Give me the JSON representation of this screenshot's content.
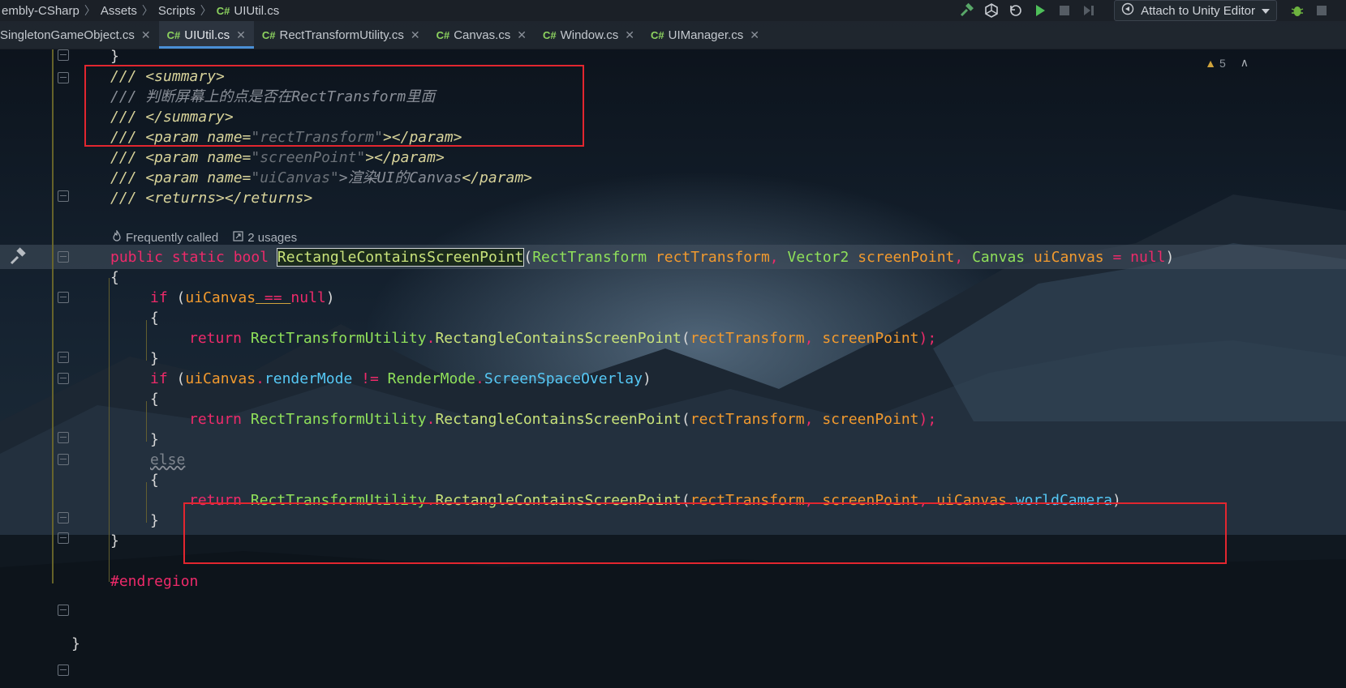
{
  "breadcrumb": {
    "items": [
      "embly-CSharp",
      "Assets",
      "Scripts",
      "UIUtil.cs"
    ],
    "file_glyph": "C#"
  },
  "toolbar": {
    "attach_label": "Attach to Unity Editor"
  },
  "tabs": [
    {
      "label": "SingletonGameObject.cs",
      "active": false
    },
    {
      "label": "UIUtil.cs",
      "active": true
    },
    {
      "label": "RectTransformUtility.cs",
      "active": false
    },
    {
      "label": "Canvas.cs",
      "active": false
    },
    {
      "label": "Window.cs",
      "active": false
    },
    {
      "label": "UIManager.cs",
      "active": false
    }
  ],
  "inspection": {
    "warnings": "5"
  },
  "code_hint": {
    "frequently_called": "Frequently called",
    "usages": "2 usages"
  },
  "code": {
    "l_close_brace_top": "}",
    "doc_summary_open": "/// <summary>",
    "doc_summary_text": "/// 判断屏幕上的点是否在RectTransform里面",
    "doc_summary_close": "/// </summary>",
    "doc_param_1_prefix": "/// <param name=",
    "doc_param_1_val": "\"rectTransform\"",
    "doc_param_1_suffix": "></param>",
    "doc_param_2_prefix": "/// <param name=",
    "doc_param_2_val": "\"screenPoint\"",
    "doc_param_2_suffix": "></param>",
    "doc_param_3_prefix": "/// <param name=",
    "doc_param_3_val": "\"uiCanvas\"",
    "doc_param_3_mid": ">渲染UI的Canvas",
    "doc_param_3_suffix": "</param>",
    "doc_returns": "/// <returns></returns>",
    "sig_kw": "public static bool ",
    "sig_name": "RectangleContainsScreenPoint",
    "sig_open": "(",
    "sig_t1": "RectTransform ",
    "sig_p1": "rectTransform",
    "sig_comma1": ", ",
    "sig_t2": "Vector2 ",
    "sig_p2": "screenPoint",
    "sig_comma2": ", ",
    "sig_t3": "Canvas ",
    "sig_p3": "uiCanvas",
    "sig_eq": " = ",
    "sig_null": "null",
    "sig_close": ")",
    "brace_open": "{",
    "brace_close": "}",
    "if1_kw": "if ",
    "if1_open": "(",
    "if1_var": "uiCanvas",
    "if1_op": " == ",
    "if1_null": "null",
    "if1_close": ")",
    "ret_kw": "return ",
    "ret_cls": "RectTransformUtility",
    "dot": ".",
    "ret_method": "RectangleContainsScreenPoint",
    "ret_open": "(",
    "ret_p1": "rectTransform",
    "ret_comma": ", ",
    "ret_p2": "screenPoint",
    "ret_close": ");",
    "if2_kw": "if ",
    "if2_open": "(",
    "if2_var": "uiCanvas",
    "if2_prop": "renderMode",
    "if2_op": " != ",
    "if2_enum": "RenderMode",
    "if2_val": "ScreenSpaceOverlay",
    "if2_close": ")",
    "else_kw": "else",
    "ret3_p3a": "uiCanvas",
    "ret3_p3b": "worldCamera",
    "ret3_close": ")",
    "endregion": "#endregion",
    "final_brace": "}"
  }
}
